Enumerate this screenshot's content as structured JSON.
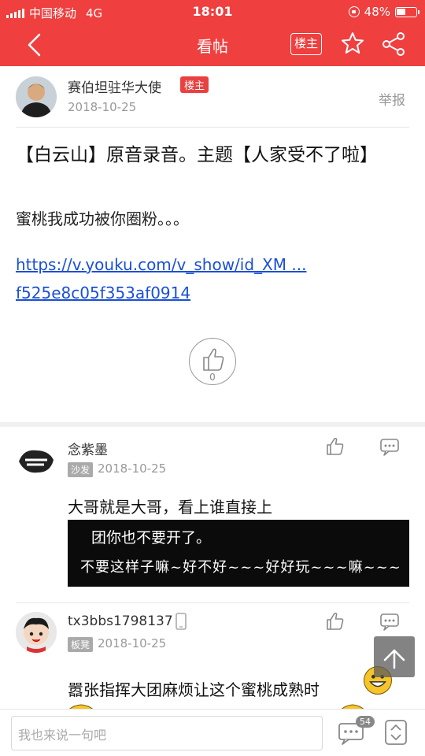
{
  "status": {
    "carrier": "中国移动",
    "network": "4G",
    "time": "18:01",
    "battery": "48%",
    "battery_level": 0.48
  },
  "nav": {
    "title": "看帖",
    "owner_label": "楼主"
  },
  "post": {
    "author": "赛伯坦驻华大使",
    "owner_tag": "楼主",
    "date": "2018-10-25",
    "report": "举报",
    "title": "【白云山】原音录音。主题【人家受不了啦】",
    "body": "蜜桃我成功被你圈粉。。。",
    "link_line1": "https://v.youku.com/v_show/id_XM ...",
    "link_line2": "f525e8c05f353af0914",
    "like_count": "0"
  },
  "replies": [
    {
      "name": "念紫墨",
      "floor": "沙发",
      "date": "2018-10-25",
      "text": "大哥就是大哥，看上谁直接上",
      "image_line1": "团你也不要开了。",
      "image_line2": "不要这样子嘛~好不好~~~好好玩~~~嘛~~~"
    },
    {
      "name": "tx3bbs1798137",
      "floor": "板凳",
      "date": "2018-10-25",
      "text": "嚣张指挥大团麻烦让这个蜜桃成熟时"
    }
  ],
  "bottom": {
    "placeholder": "我也来说一句吧",
    "comment_count": "54"
  },
  "colors": {
    "accent": "#ef3f3f",
    "link": "#1a4fd6"
  }
}
